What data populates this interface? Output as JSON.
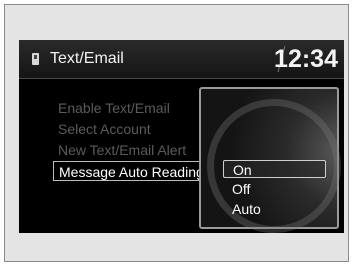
{
  "header": {
    "title": "Text/Email",
    "clock": "12:34"
  },
  "menu": {
    "items": [
      {
        "label": "Enable Text/Email"
      },
      {
        "label": "Select Account"
      },
      {
        "label": "New Text/Email Alert"
      },
      {
        "label": "Message Auto Reading"
      }
    ]
  },
  "popup": {
    "options": [
      {
        "label": "On",
        "selected": true
      },
      {
        "label": "Off"
      },
      {
        "label": "Auto"
      }
    ]
  }
}
